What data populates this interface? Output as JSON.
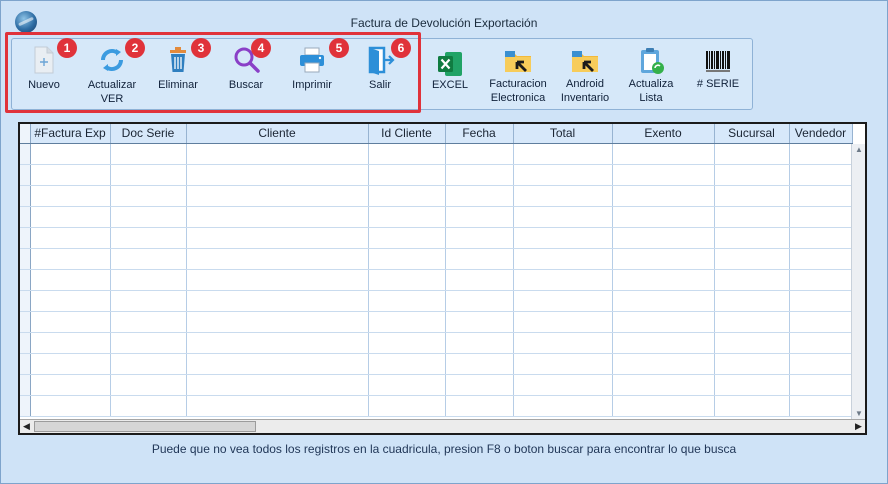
{
  "window": {
    "title": "Factura de Devolución  Exportación"
  },
  "toolbar": {
    "items": [
      {
        "label": "Nuevo",
        "icon": "new-document-icon",
        "badge": "1"
      },
      {
        "label": "Actualizar VER",
        "icon": "refresh-icon",
        "badge": "2"
      },
      {
        "label": "Eliminar",
        "icon": "trash-icon",
        "badge": "3"
      },
      {
        "label": "Buscar",
        "icon": "magnifier-icon",
        "badge": "4"
      },
      {
        "label": "Imprimir",
        "icon": "printer-icon",
        "badge": "5"
      },
      {
        "label": "Salir",
        "icon": "exit-door-icon",
        "badge": "6"
      },
      {
        "label": "EXCEL",
        "icon": "excel-icon"
      },
      {
        "label": "Facturacion Electronica",
        "icon": "folder-arrow-icon"
      },
      {
        "label": "Android Inventario",
        "icon": "folder-arrow-icon"
      },
      {
        "label": "Actualiza Lista",
        "icon": "clipboard-refresh-icon"
      },
      {
        "label": "# SERIE",
        "icon": "barcode-icon"
      }
    ]
  },
  "grid": {
    "columns": [
      "#Factura Exp",
      "Doc Serie",
      "Cliente",
      "Id Cliente",
      "Fecha",
      "Total",
      "Exento",
      "Sucursal",
      "Vendedor"
    ],
    "row_count": 13
  },
  "footer": {
    "hint": "Puede que no vea todos los registros en la cuadricula, presion F8 o boton buscar para encontrar lo que busca"
  },
  "colors": {
    "window_bg": "#cfe3f7",
    "header_bg": "#d7e8fa",
    "highlight": "#e0323a",
    "badge": "#e0323a"
  }
}
